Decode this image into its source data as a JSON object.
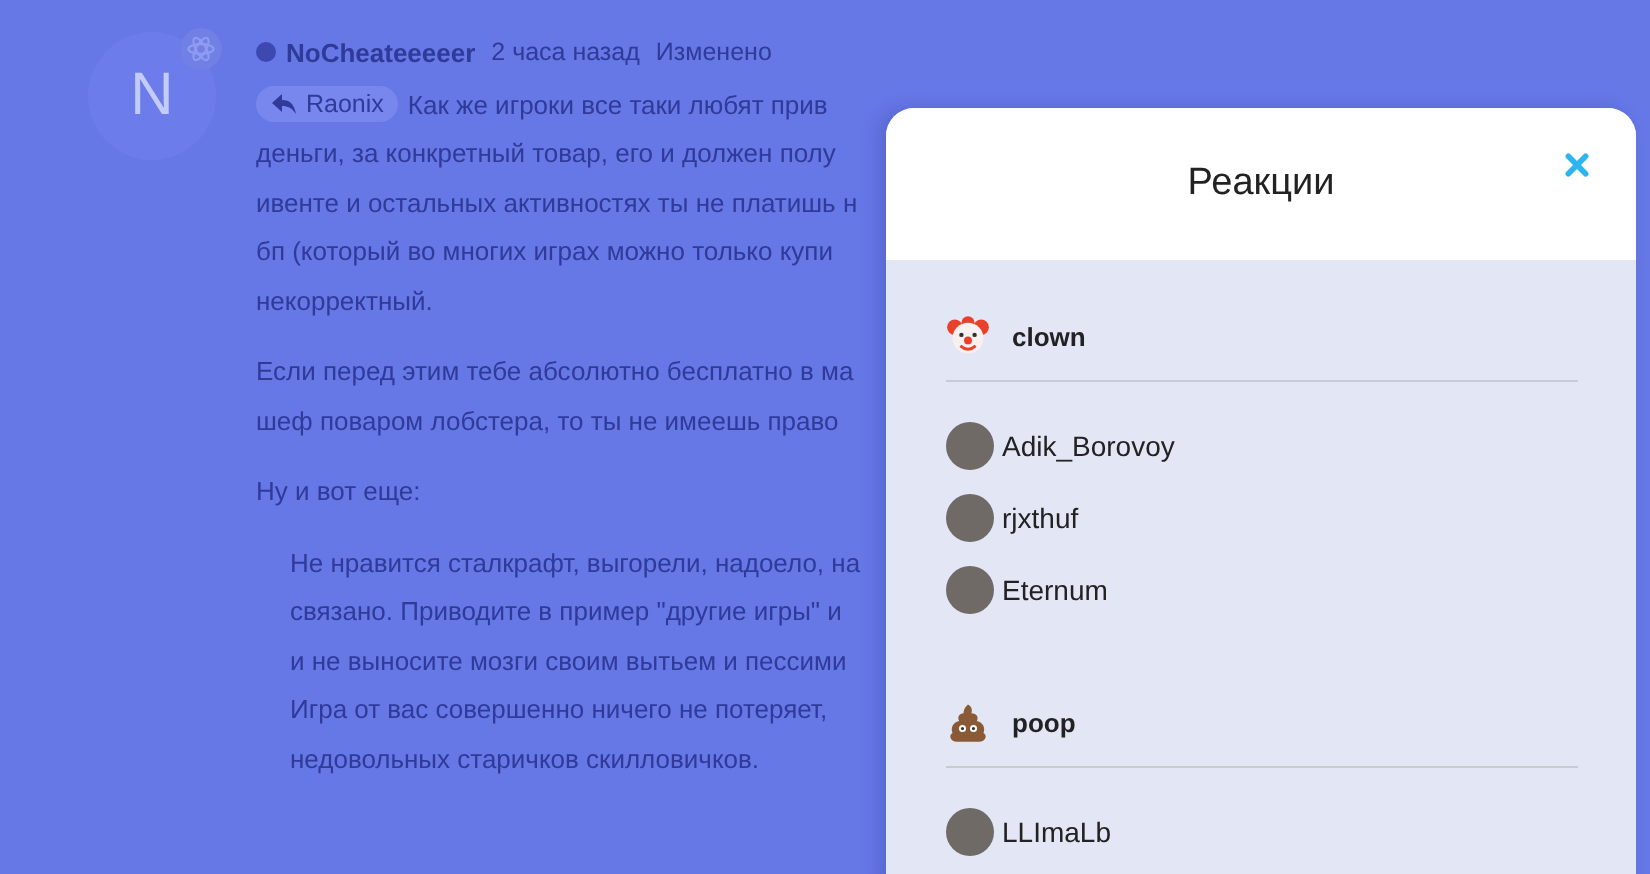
{
  "post": {
    "avatar_letter": "N",
    "author": "NoCheateeeeer",
    "time": "2 часа назад",
    "edited": "Изменено",
    "reply_to": "Raonix",
    "first_line": "Как же игроки все таки любят прив",
    "paragraphs": [
      [
        "деньги, за конкретный товар, его и должен полу",
        "ивенте и остальных активностях ты не платишь н",
        "бп (который во многих играх можно только купи",
        "некорректный."
      ],
      [
        "Если перед этим тебе абсолютно бесплатно в ма",
        "шеф поваром лобстера, то ты не имеешь право"
      ],
      [
        "Ну и вот еще:"
      ]
    ],
    "quote": [
      "Не нравится сталкрафт, выгорели, надоело, на",
      "связано. Приводите в пример \"другие игры\" и",
      "и не выносите мозги своим вытьем и пессими",
      "Игра от вас совершенно ничего не потеряет,",
      "недовольных старичков скилловичков."
    ]
  },
  "modal": {
    "title": "Реакции",
    "reactions": [
      {
        "kind": "clown",
        "name": "clown",
        "users": [
          "Adik_Borovoy",
          "rjxthuf",
          "Eternum"
        ]
      },
      {
        "kind": "poop",
        "name": "poop",
        "users": [
          "LLImaLb"
        ]
      }
    ]
  }
}
